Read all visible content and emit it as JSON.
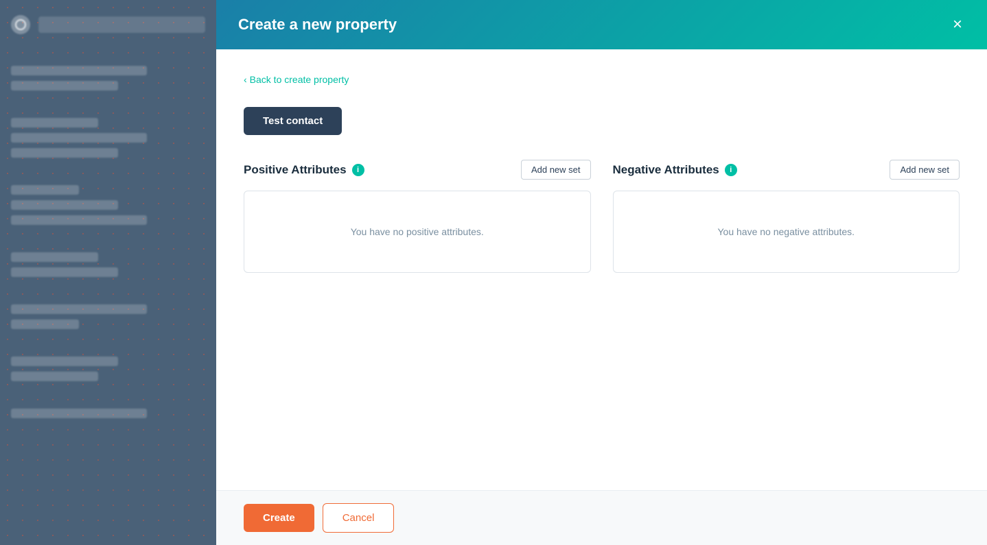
{
  "sidebar": {
    "logo_alt": "HubSpot logo"
  },
  "modal": {
    "header": {
      "title": "Create a new property",
      "close_label": "×"
    },
    "back_link": {
      "chevron": "‹",
      "label": "Back to create property"
    },
    "test_contact_button": "Test contact",
    "positive_attributes": {
      "title": "Positive Attributes",
      "info_icon": "i",
      "add_button": "Add new set",
      "empty_text": "You have no positive attributes."
    },
    "negative_attributes": {
      "title": "Negative Attributes",
      "info_icon": "i",
      "add_button": "Add new set",
      "empty_text": "You have no negative attributes."
    },
    "footer": {
      "create_label": "Create",
      "cancel_label": "Cancel"
    }
  }
}
